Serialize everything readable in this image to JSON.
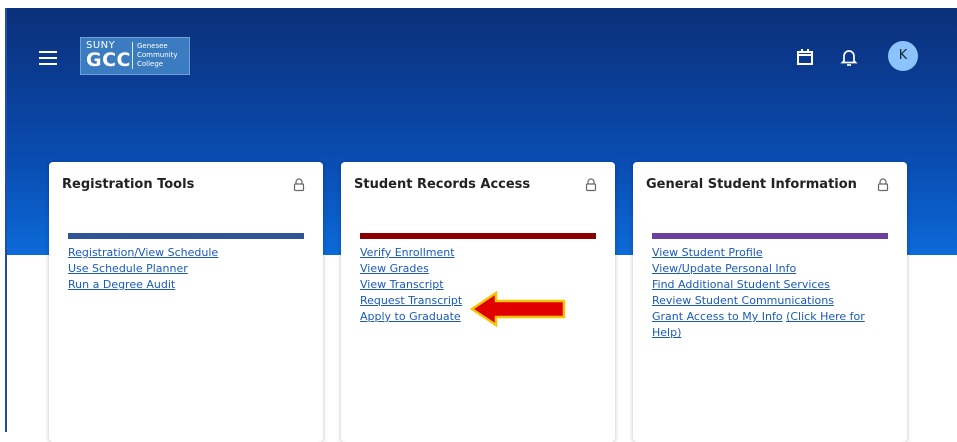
{
  "header": {
    "logo": {
      "suny": "SUNY",
      "gcc": "GCC",
      "college_line1": "Genesee",
      "college_line2": "Community",
      "college_line3": "College"
    },
    "avatar_initial": "K",
    "icons": [
      "menu-icon",
      "calendar-icon",
      "bell-icon"
    ]
  },
  "cards": [
    {
      "title": "Registration Tools",
      "accent": "#2f5597",
      "links": [
        "Registration/View Schedule",
        "Use Schedule Planner",
        "Run a Degree Audit"
      ]
    },
    {
      "title": "Student Records Access",
      "accent": "#8b0000",
      "links": [
        "Verify Enrollment",
        "View Grades",
        "View Transcript",
        "Request Transcript",
        "Apply to Graduate"
      ]
    },
    {
      "title": "General Student Information",
      "accent": "#6a3fa0",
      "links": [
        "View Student Profile",
        "View/Update Personal Info",
        "Find Additional Student Services",
        "Review Student Communications",
        "Grant Access to My Info",
        "(Click Here for",
        "Help)"
      ]
    }
  ],
  "annotation": {
    "arrow_color": "#e00000",
    "arrow_outline": "#f3c600"
  }
}
